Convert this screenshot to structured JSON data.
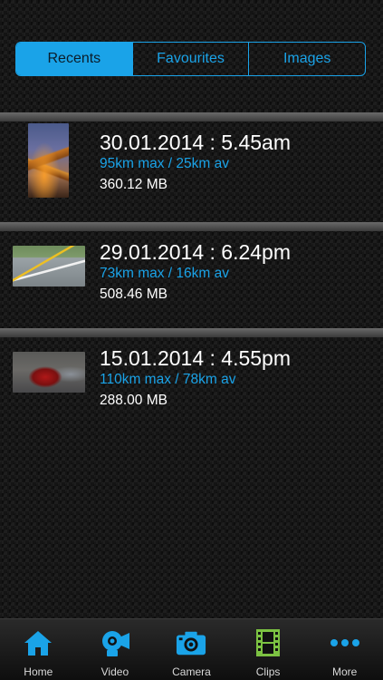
{
  "segments": [
    {
      "label": "Recents",
      "active": true
    },
    {
      "label": "Favourites",
      "active": false
    },
    {
      "label": "Images",
      "active": false
    }
  ],
  "recordings": [
    {
      "date": "30.01.2014 : 5.45am",
      "speed": "95km max / 25km av",
      "size": "360.12 MB",
      "thumbnail": "bridge-at-dusk"
    },
    {
      "date": "29.01.2014 : 6.24pm",
      "speed": "73km max / 16km av",
      "size": "508.46 MB",
      "thumbnail": "road-markings"
    },
    {
      "date": "15.01.2014 : 4.55pm",
      "speed": "110km max / 78km av",
      "size": "288.00 MB",
      "thumbnail": "red-car-rear"
    }
  ],
  "tabbar": [
    {
      "label": "Home",
      "icon": "house-icon",
      "color": "#1aa3e8"
    },
    {
      "label": "Video",
      "icon": "video-camera-icon",
      "color": "#1aa3e8"
    },
    {
      "label": "Camera",
      "icon": "camera-icon",
      "color": "#1aa3e8"
    },
    {
      "label": "Clips",
      "icon": "film-strip-icon",
      "color": "#7cc242"
    },
    {
      "label": "More",
      "icon": "more-dots-icon",
      "color": "#1aa3e8"
    }
  ],
  "colors": {
    "accent": "#1aa3e8",
    "clips_green": "#7cc242"
  }
}
